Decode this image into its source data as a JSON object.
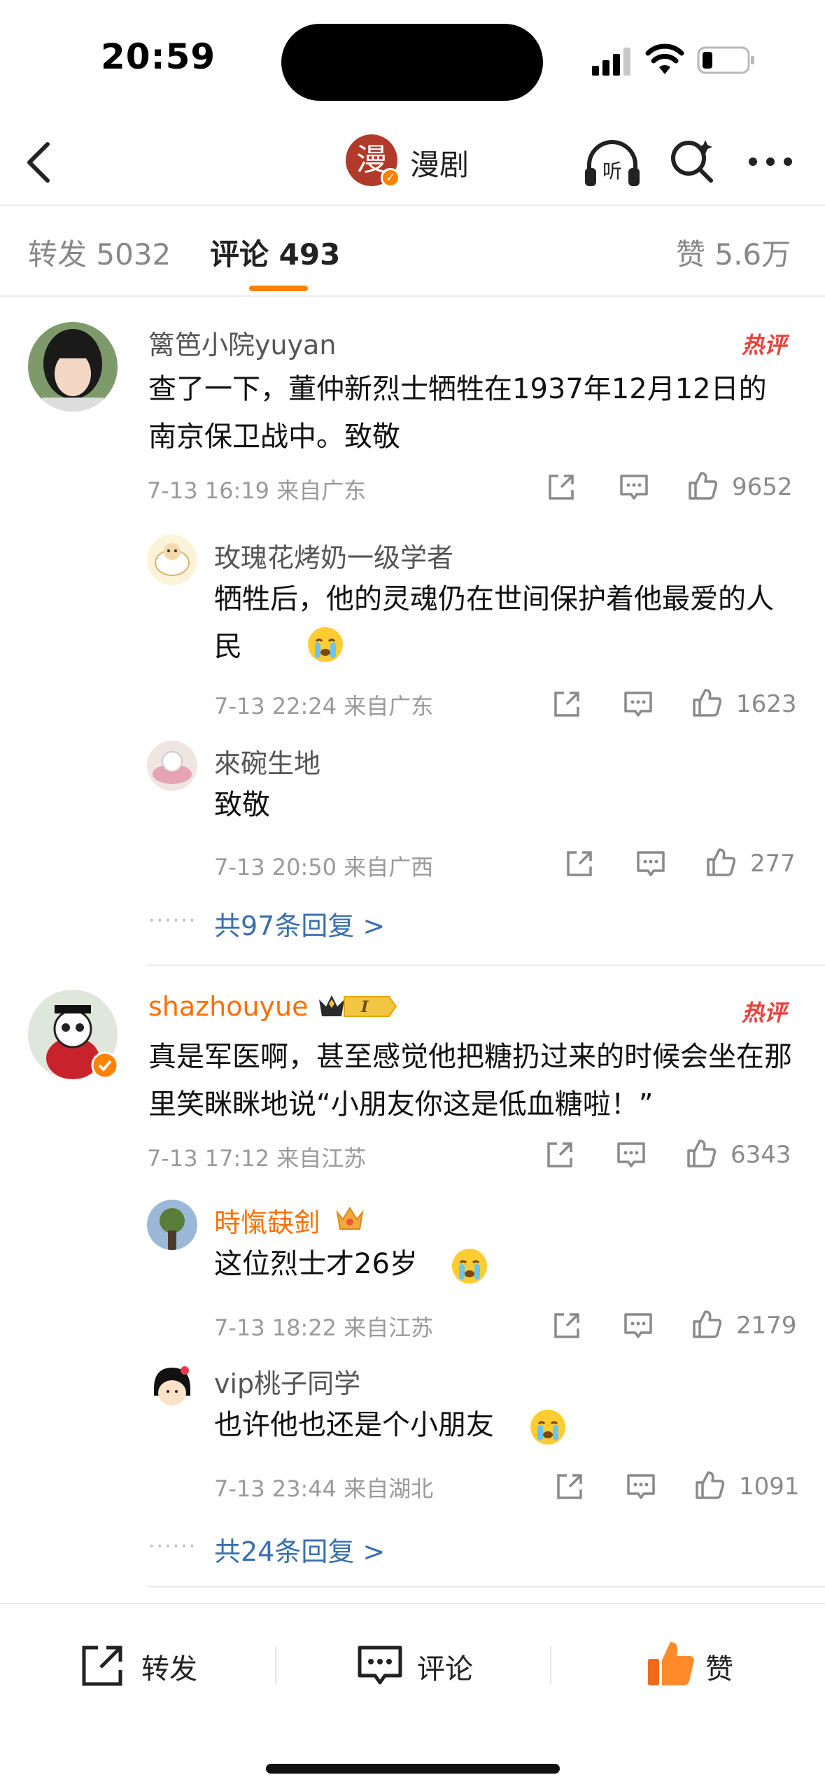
{
  "status_bar": {
    "time": "20:59"
  },
  "nav": {
    "avatar_char": "漫",
    "title": "漫剧"
  },
  "tabs": [
    {
      "label": "转发 5032"
    },
    {
      "label": "评论 493"
    },
    {
      "label": "赞 5.6万"
    }
  ],
  "comments": [
    {
      "user": "篱笆小院yuyan",
      "hot_label": "热评",
      "text": "查了一下，董仲新烈士牺牲在1937年12月12日的南京保卫战中。致敬",
      "meta": "7-13 16:19  来自广东",
      "likes": "9652",
      "replies": [
        {
          "user": "玫瑰花烤奶一级学者",
          "text": "牺牲后，他的灵魂仍在世间保护着他最爱的人民",
          "meta": "7-13 22:24  来自广东",
          "likes": "1623"
        },
        {
          "user": "來碗生地",
          "text": "致敬",
          "meta": "7-13 20:50  来自广西",
          "likes": "277"
        }
      ],
      "more_replies": "共97条回复 >"
    },
    {
      "user": "shazhouyue",
      "hot_label": "热评",
      "text": "真是军医啊，甚至感觉他把糖扔过来的时候会坐在那里笑眯眯地说“小朋友你这是低血糖啦！”",
      "meta": "7-13 17:12  来自江苏",
      "likes": "6343",
      "replies": [
        {
          "user": "時愾蒛釗",
          "text": "这位烈士才26岁",
          "meta": "7-13 18:22  来自江苏",
          "likes": "2179"
        },
        {
          "user": "vip桃子同学",
          "text": "也许他也还是个小朋友",
          "meta": "7-13 23:44  来自湖北",
          "likes": "1091"
        }
      ],
      "more_replies": "共24条回复 >"
    }
  ],
  "bottom_bar": {
    "repost": "转发",
    "comment": "评论",
    "like": "赞"
  },
  "colors": {
    "accent": "#ff8200",
    "link": "#3a6fb0",
    "hot": "#e8413a"
  }
}
